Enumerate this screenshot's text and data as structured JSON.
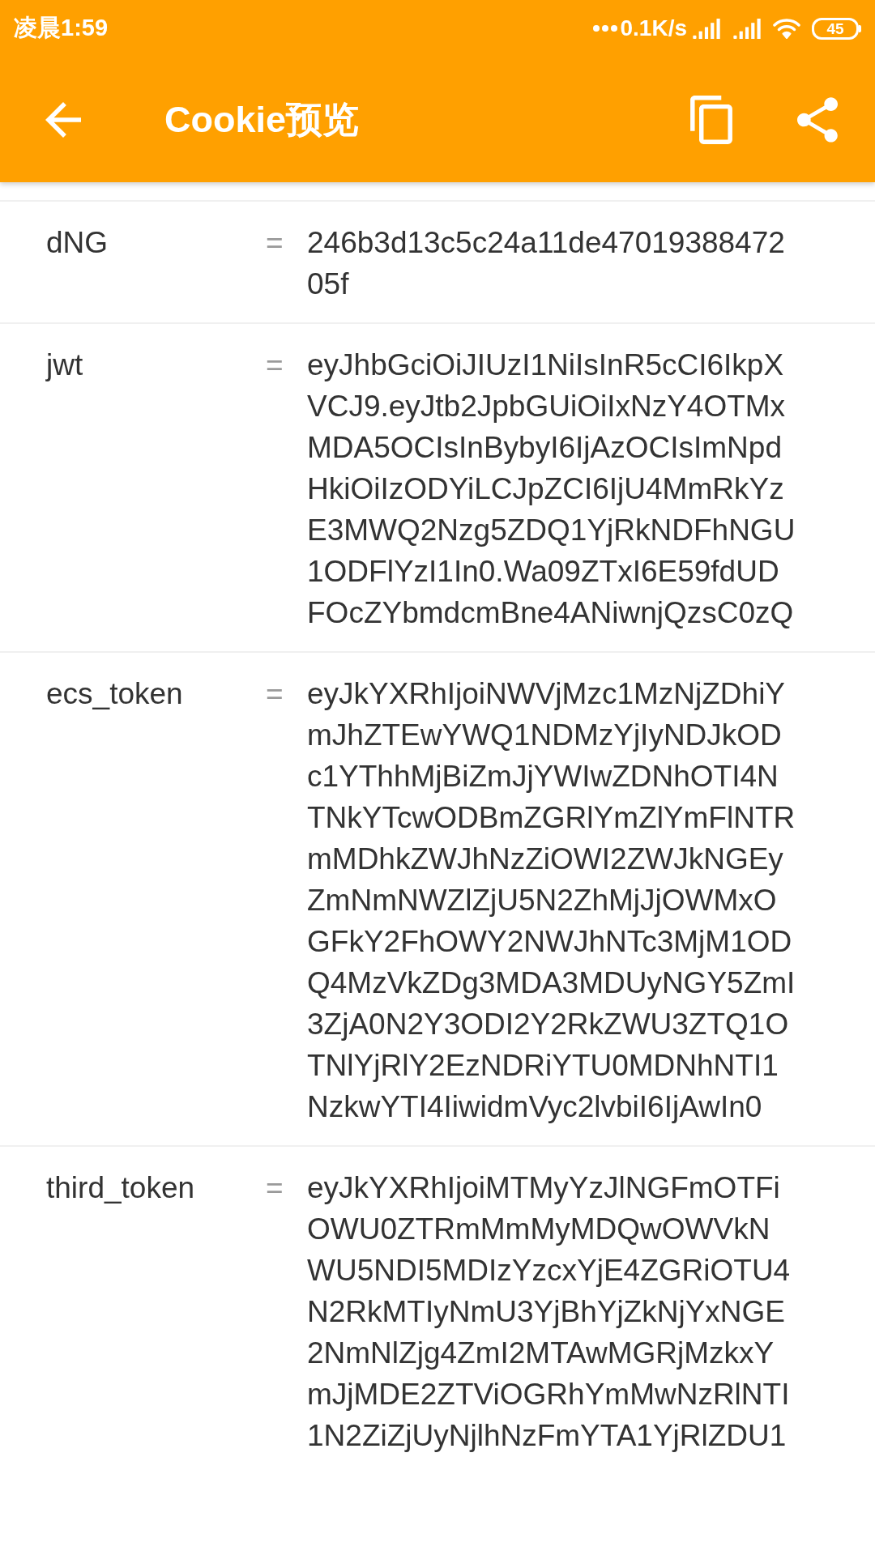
{
  "status_bar": {
    "time": "凌晨1:59",
    "network_speed": "0.1K/s",
    "battery": "45"
  },
  "toolbar": {
    "title": "Cookie预览"
  },
  "cookies": [
    {
      "name": "dNG",
      "separator": "=",
      "value": "246b3d13c5c24a11de4701938847205f"
    },
    {
      "name": "jwt",
      "separator": "=",
      "value": "eyJhbGciOiJIUzI1NiIsInR5cCI6IkpXVCJ9.eyJtb2JpbGUiOiIxNzY4OTMxMDA5OCIsInBybyI6IjAzOCIsImNpdHkiOiIzODYiLCJpZCI6IjU4MmRkYzE3MWQ2Nzg5ZDQ1YjRkNDFhNGU1ODFlYzI1In0.Wa09ZTxI6E59fdUDFOcZYbmdcmBne4ANiwnjQzsC0zQ"
    },
    {
      "name": "ecs_token",
      "separator": "=",
      "value": "eyJkYXRhIjoiNWVjMzc1MzNjZDhiYmJhZTEwYWQ1NDMzYjIyNDJkODc1YThhMjBiZmJjYWIwZDNhOTI4NTNkYTcwODBmZGRlYmZlYmFlNTRmMDhkZWJhNzZiOWI2ZWJkNGEyZmNmNWZlZjU5N2ZhMjJjOWMxOGFkY2FhOWY2NWJhNTc3MjM1ODQ4MzVkZDg3MDA3MDUyNGY5ZmI3ZjA0N2Y3ODI2Y2RkZWU3ZTQ1OTNlYjRlY2EzNDRiYTU0MDNhNTI1NzkwYTI4IiwidmVyc2lvbiI6IjAwIn0"
    },
    {
      "name": "third_token",
      "separator": "=",
      "value": "eyJkYXRhIjoiMTMyYzJlNGFmOTFiOWU0ZTRmMmMyMDQwOWVkNWU5NDI5MDIzYzcxYjE4ZGRiOTU4N2RkMTIyNmU3YjBhYjZkNjYxNGE2NmNlZjg4ZmI2MTAwMGRjMzkxYmJjMDE2ZTViOGRhYmMwNzRlNTI1N2ZiZjUyNjlhNzFmYTA1YjRlZDU1"
    }
  ]
}
